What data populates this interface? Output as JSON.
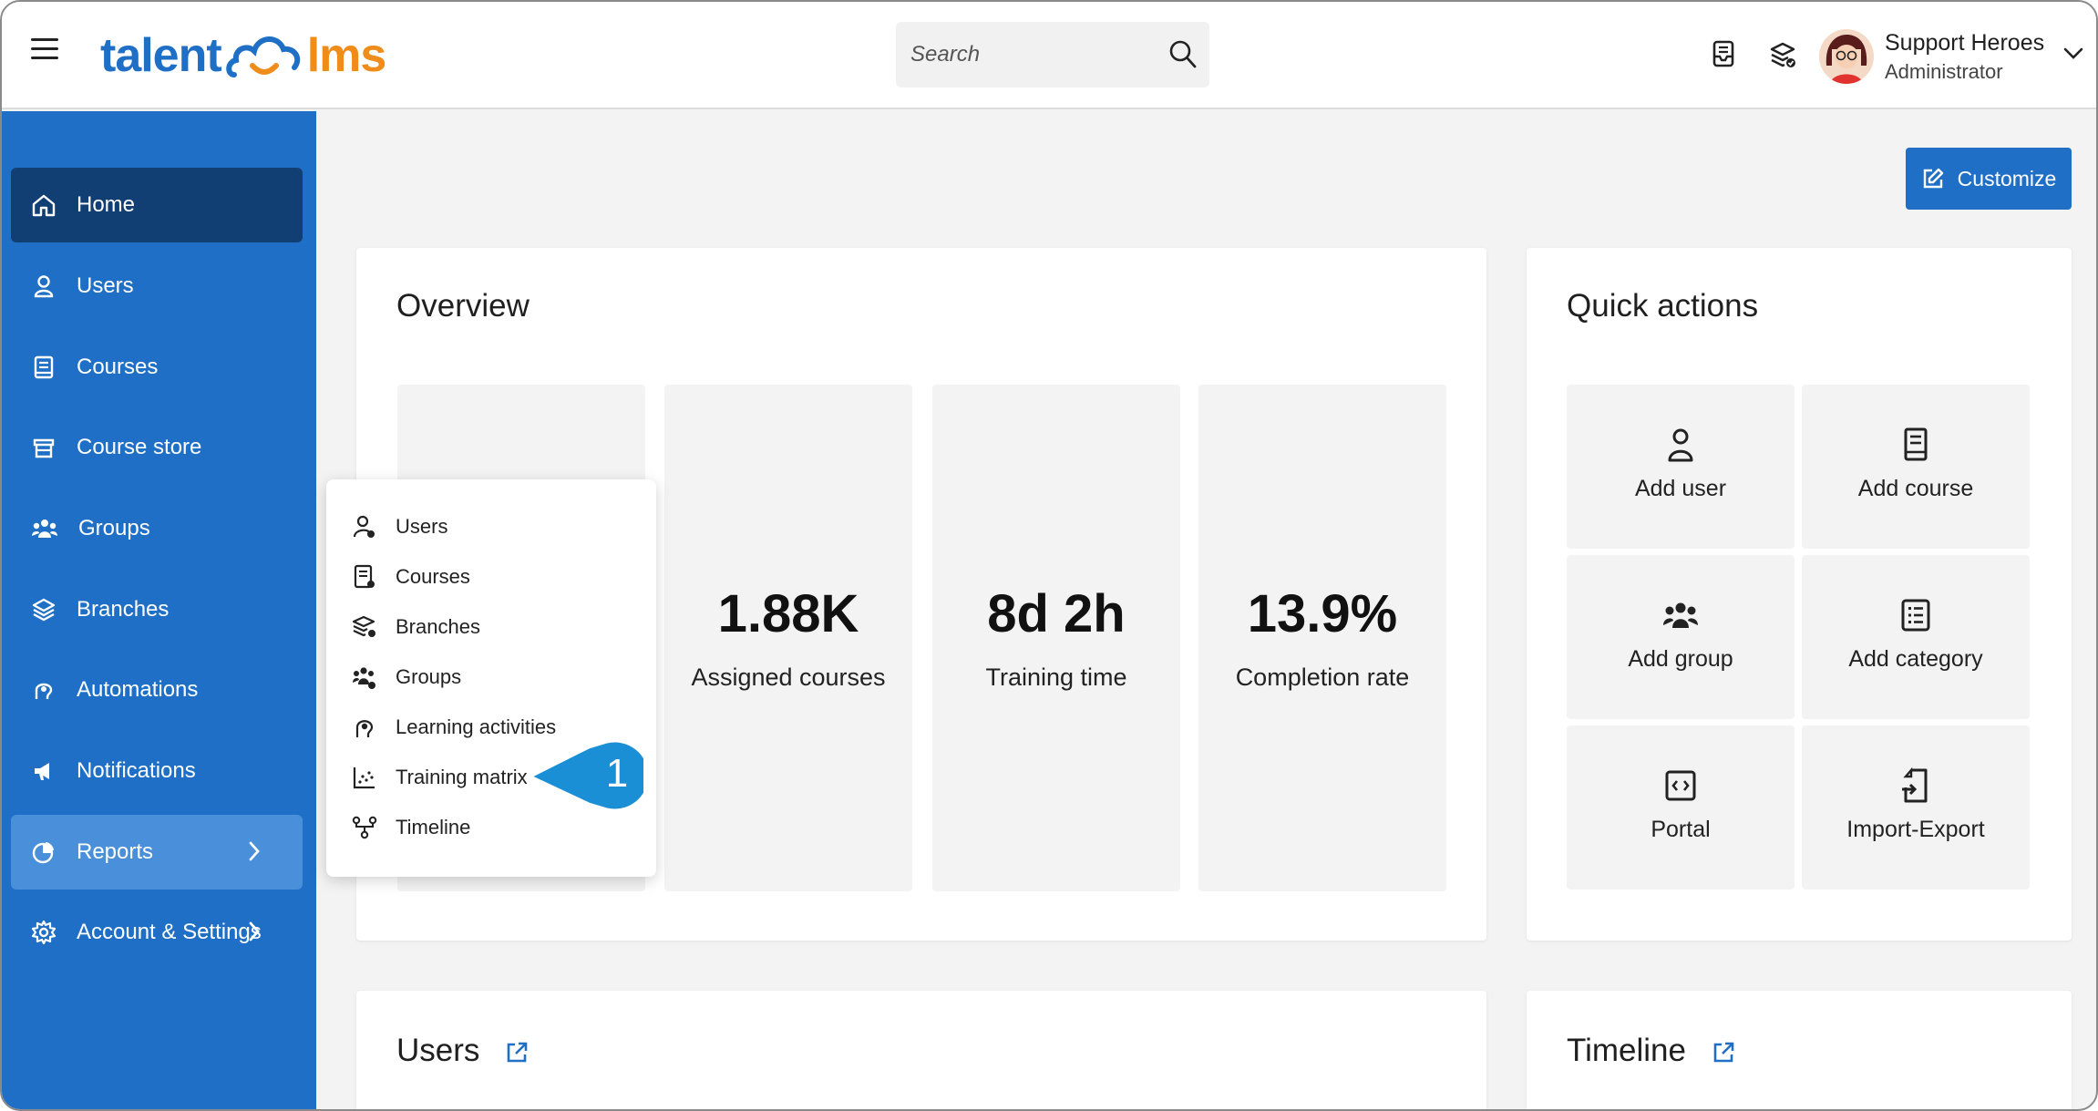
{
  "header": {
    "logo_part1": "talent",
    "logo_part2": "lms",
    "search_placeholder": "Search",
    "user_name": "Support Heroes",
    "user_role": "Administrator"
  },
  "sidebar": {
    "items": [
      {
        "label": "Home",
        "icon": "home-icon"
      },
      {
        "label": "Users",
        "icon": "user-icon"
      },
      {
        "label": "Courses",
        "icon": "book-icon"
      },
      {
        "label": "Course store",
        "icon": "store-icon"
      },
      {
        "label": "Groups",
        "icon": "group-icon"
      },
      {
        "label": "Branches",
        "icon": "layers-icon"
      },
      {
        "label": "Automations",
        "icon": "automation-icon"
      },
      {
        "label": "Notifications",
        "icon": "megaphone-icon"
      },
      {
        "label": "Reports",
        "icon": "pie-chart-icon"
      },
      {
        "label": "Account & Settings",
        "icon": "gear-icon"
      }
    ]
  },
  "main": {
    "customize_label": "Customize",
    "overview": {
      "title": "Overview",
      "stats": [
        {
          "value": "1.88K",
          "label": "Assigned courses"
        },
        {
          "value": "8d 2h",
          "label": "Training time"
        },
        {
          "value": "13.9%",
          "label": "Completion rate"
        }
      ]
    },
    "quick_actions": {
      "title": "Quick actions",
      "items": [
        {
          "label": "Add user",
          "icon": "user-icon"
        },
        {
          "label": "Add course",
          "icon": "book-icon"
        },
        {
          "label": "Add group",
          "icon": "group-icon"
        },
        {
          "label": "Add category",
          "icon": "list-icon"
        },
        {
          "label": "Portal",
          "icon": "code-icon"
        },
        {
          "label": "Import-Export",
          "icon": "import-export-icon"
        }
      ]
    },
    "users_title": "Users",
    "timeline_title": "Timeline"
  },
  "reports_menu": {
    "items": [
      {
        "label": "Users",
        "icon": "user-report-icon"
      },
      {
        "label": "Courses",
        "icon": "course-report-icon"
      },
      {
        "label": "Branches",
        "icon": "branches-report-icon"
      },
      {
        "label": "Groups",
        "icon": "groups-report-icon"
      },
      {
        "label": "Learning activities",
        "icon": "learning-activities-icon"
      },
      {
        "label": "Training matrix",
        "icon": "scatter-icon"
      },
      {
        "label": "Timeline",
        "icon": "timeline-icon"
      }
    ],
    "callout_number": "1"
  },
  "colors": {
    "brand_blue": "#1e6fc5",
    "brand_orange": "#f08c1a",
    "sidebar_active": "#123f73",
    "sidebar_hover": "#4a8fd9",
    "callout": "#1a8fd6"
  }
}
